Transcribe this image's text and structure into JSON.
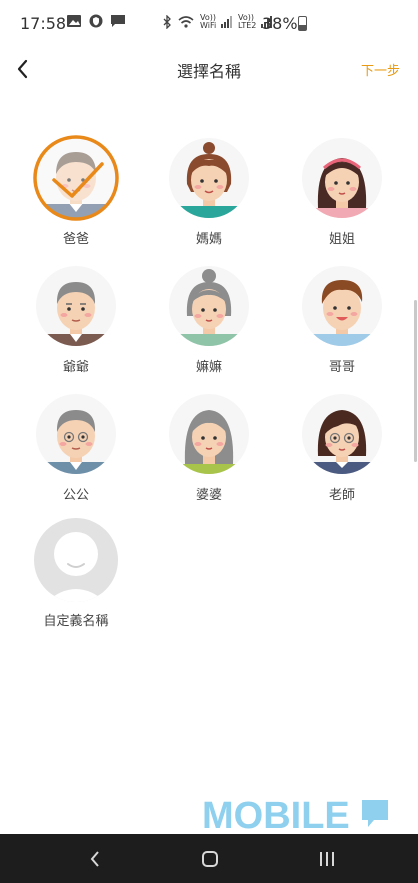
{
  "status_bar": {
    "time": "17:58",
    "battery": "38%",
    "wifi_label": "Vo))\nWiFi",
    "lte_label": "Vo))\nLTE2",
    "left_icons": [
      "image-icon",
      "shield-icon",
      "message-icon"
    ],
    "right_icons": [
      "bluetooth-icon",
      "wifi-icon",
      "signal-icon",
      "signal-icon",
      "battery-icon"
    ]
  },
  "header": {
    "title": "選擇名稱",
    "next_label": "下一步",
    "back_icon": "chevron-left-icon"
  },
  "colors": {
    "accent": "#e89a12",
    "selected_ring": "#e8891a",
    "nav_bar": "#1d1d1d"
  },
  "avatars": [
    {
      "label": "爸爸",
      "selected": true
    },
    {
      "label": "媽媽",
      "selected": false
    },
    {
      "label": "姐姐",
      "selected": false
    },
    {
      "label": "爺爺",
      "selected": false
    },
    {
      "label": "嫲嫲",
      "selected": false
    },
    {
      "label": "哥哥",
      "selected": false
    },
    {
      "label": "公公",
      "selected": false
    },
    {
      "label": "婆婆",
      "selected": false
    },
    {
      "label": "老師",
      "selected": false
    },
    {
      "label": "自定義名稱",
      "selected": false
    }
  ],
  "watermark": "MOBILE",
  "nav": {
    "back_icon": "back-icon",
    "home_icon": "home-icon",
    "recents_icon": "recents-icon"
  }
}
